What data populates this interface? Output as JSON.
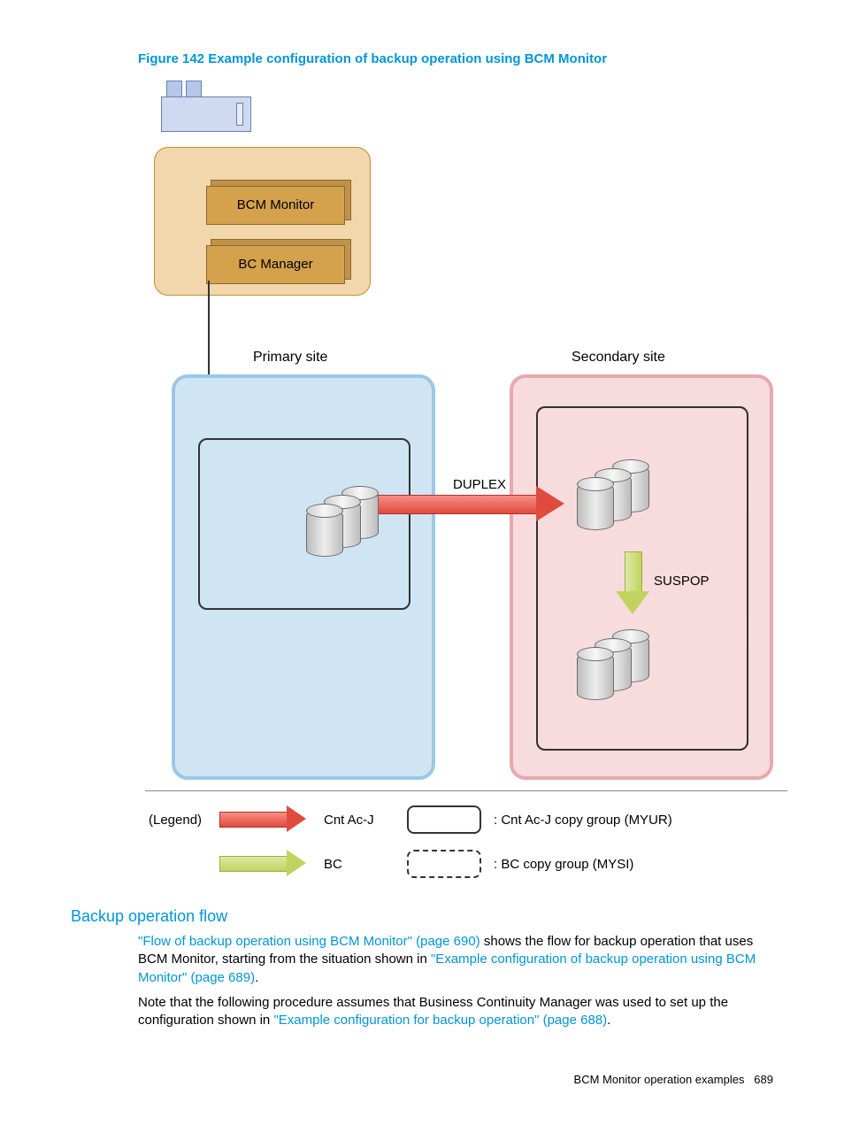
{
  "figure": {
    "caption": "Figure 142 Example configuration of backup operation using BCM Monitor",
    "host_modules": {
      "top": "BCM Monitor",
      "bottom": "BC Manager"
    },
    "sites": {
      "primary": "Primary site",
      "secondary": "Secondary site"
    },
    "arrow_labels": {
      "duplex": "DUPLEX",
      "suspop": "SUSPOP"
    },
    "legend": {
      "title": "(Legend)",
      "row1": {
        "arrow": "Cnt Ac-J",
        "box": ": Cnt Ac-J   copy group (MYUR)"
      },
      "row2": {
        "arrow": "BC",
        "box": ": BC   copy group (MYSI)"
      }
    }
  },
  "section_heading": "Backup operation flow",
  "para1": {
    "link1": "\"Flow of backup operation using BCM Monitor\" (page 690)",
    "mid1": " shows the flow for backup operation that uses BCM Monitor, starting from the situation shown in ",
    "link2": "\"Example configuration of backup operation using BCM Monitor\" (page 689)",
    "end": "."
  },
  "para2": {
    "pre": "Note that the following procedure assumes that Business Continuity Manager was used to set up the configuration shown in ",
    "link": "\"Example configuration for backup operation\" (page 688)",
    "end": "."
  },
  "footer": {
    "section": "BCM Monitor operation examples",
    "page": "689"
  }
}
